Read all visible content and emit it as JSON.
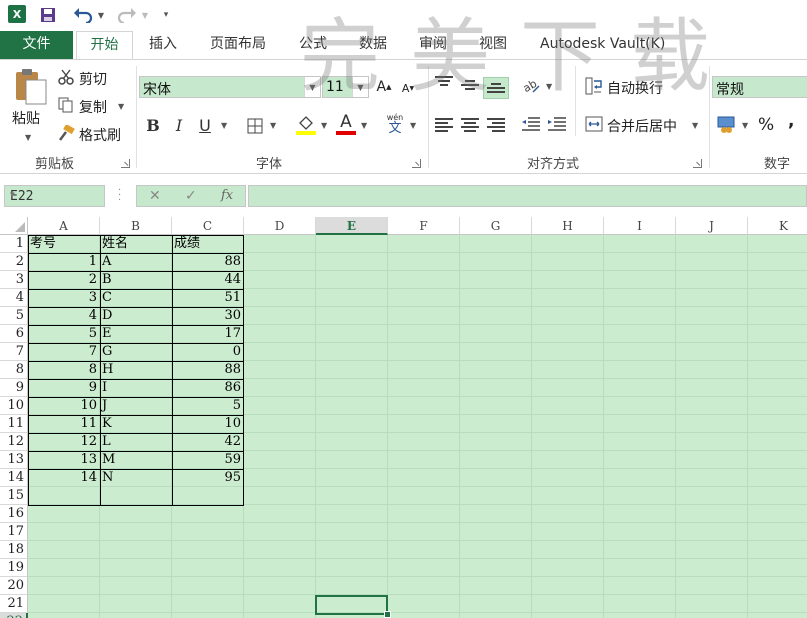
{
  "quick_access": {
    "logo_letter": "X",
    "save_icon": "save-icon",
    "undo_icon": "undo-icon",
    "redo_icon": "redo-icon"
  },
  "tabs": [
    {
      "label": "文件"
    },
    {
      "label": "开始"
    },
    {
      "label": "插入"
    },
    {
      "label": "页面布局"
    },
    {
      "label": "公式"
    },
    {
      "label": "数据"
    },
    {
      "label": "审阅"
    },
    {
      "label": "视图"
    },
    {
      "label": "Autodesk Vault(K)"
    }
  ],
  "watermark": "完美下载",
  "ribbon": {
    "clipboard": {
      "paste": "粘贴",
      "cut": "剪切",
      "copy": "复制",
      "format_painter": "格式刷",
      "group_label": "剪贴板"
    },
    "font": {
      "font_name": "宋体",
      "font_size": "11",
      "grow": "A",
      "shrink": "A",
      "bold": "B",
      "italic": "I",
      "underline": "U",
      "font_color_letter": "A",
      "phonetic_top": "wén",
      "phonetic_bottom": "文",
      "group_label": "字体"
    },
    "alignment": {
      "wrap_text": "自动换行",
      "merge_center": "合并后居中",
      "group_label": "对齐方式"
    },
    "number": {
      "format": "常规",
      "percent": "%",
      "comma": ",",
      "group_label": "数字"
    }
  },
  "formula_bar": {
    "name_box": "E22",
    "cancel": "✕",
    "enter": "✓",
    "fx": "fx",
    "formula": ""
  },
  "columns": [
    "A",
    "B",
    "C",
    "D",
    "E",
    "F",
    "G",
    "H",
    "I",
    "J",
    "K"
  ],
  "rows": [
    "1",
    "2",
    "3",
    "4",
    "5",
    "6",
    "7",
    "8",
    "9",
    "10",
    "11",
    "12",
    "13",
    "14",
    "15",
    "16",
    "17",
    "18",
    "19",
    "20",
    "21",
    "22"
  ],
  "selected": {
    "column": "E",
    "row": "22"
  },
  "sheet": {
    "header": [
      "考号",
      "姓名",
      "成绩"
    ],
    "records": [
      [
        "1",
        "A",
        "88"
      ],
      [
        "2",
        "B",
        "44"
      ],
      [
        "3",
        "C",
        "51"
      ],
      [
        "4",
        "D",
        "30"
      ],
      [
        "5",
        "E",
        "17"
      ],
      [
        "7",
        "G",
        "0"
      ],
      [
        "8",
        "H",
        "88"
      ],
      [
        "9",
        "I",
        "86"
      ],
      [
        "10",
        "J",
        "5"
      ],
      [
        "11",
        "K",
        "10"
      ],
      [
        "12",
        "L",
        "42"
      ],
      [
        "13",
        "M",
        "59"
      ],
      [
        "14",
        "N",
        "95"
      ]
    ]
  },
  "colors": {
    "accent": "#217346",
    "cell_fill": "#cceccf"
  }
}
